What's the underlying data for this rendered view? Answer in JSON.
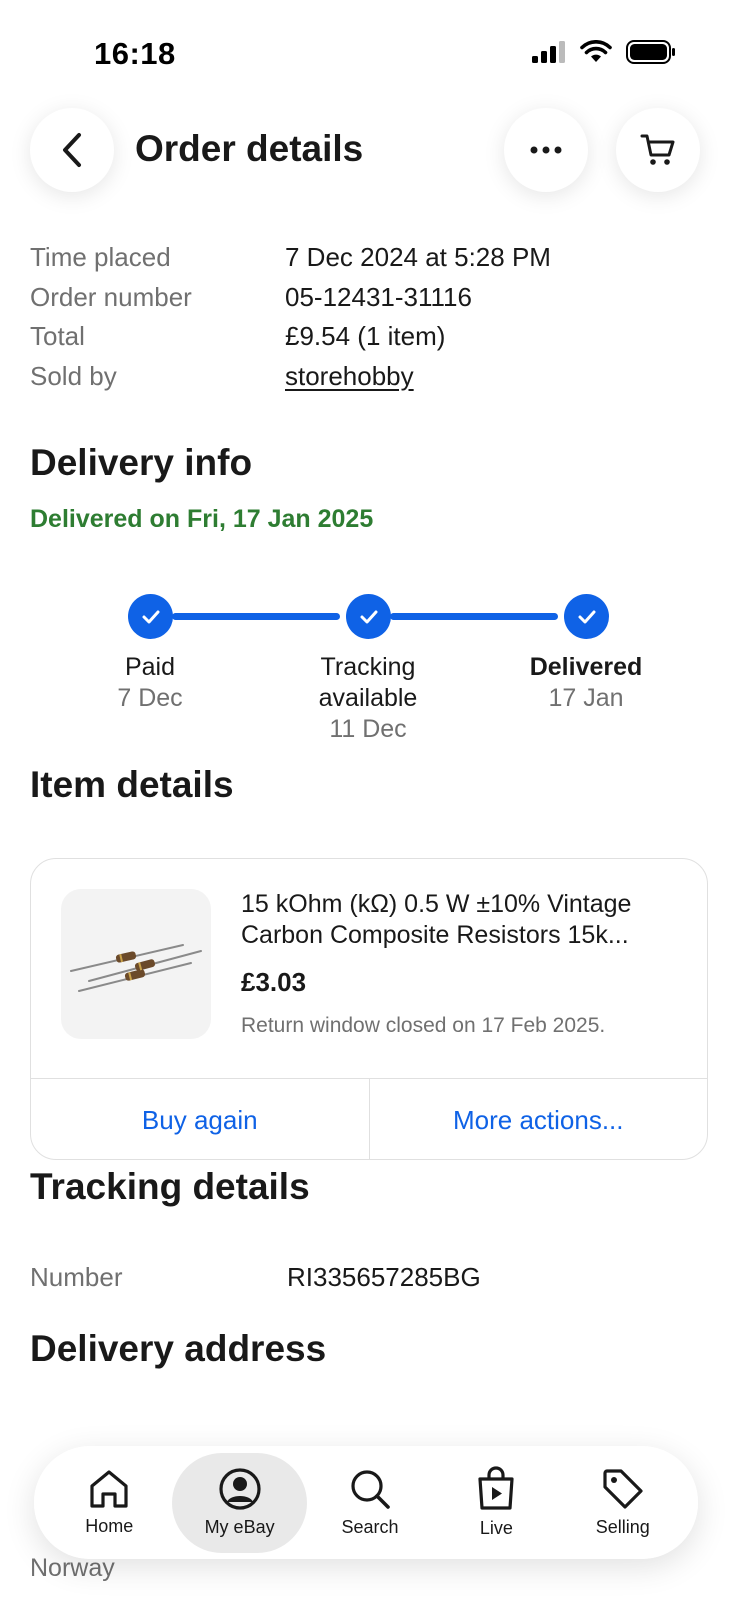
{
  "status_bar": {
    "time": "16:18"
  },
  "header": {
    "title": "Order details"
  },
  "order": {
    "rows": [
      {
        "label": "Time placed",
        "value": "7 Dec 2024 at 5:28 PM"
      },
      {
        "label": "Order number",
        "value": "05-12431-31116"
      },
      {
        "label": "Total",
        "value": "£9.54 (1 item)"
      },
      {
        "label": "Sold by",
        "value": "storehobby"
      }
    ]
  },
  "delivery": {
    "heading": "Delivery info",
    "status": "Delivered on Fri, 17 Jan 2025",
    "steps": [
      {
        "label": "Paid",
        "date": "7 Dec"
      },
      {
        "label": "Tracking available",
        "date": "11 Dec"
      },
      {
        "label": "Delivered",
        "date": "17 Jan"
      }
    ]
  },
  "item_details": {
    "heading": "Item details",
    "title": "15 kOhm (kΩ) 0.5 W ±10% Vintage Carbon Composite Resistors 15k...",
    "price": "£3.03",
    "return_note": "Return window closed on 17 Feb 2025.",
    "buy_again": "Buy again",
    "more_actions": "More actions..."
  },
  "tracking": {
    "heading": "Tracking details",
    "label": "Number",
    "value": "RI335657285BG"
  },
  "address": {
    "heading": "Delivery address",
    "country": "Norway"
  },
  "nav": [
    {
      "label": "Home",
      "icon": "home-icon"
    },
    {
      "label": "My eBay",
      "icon": "user-icon",
      "active": true
    },
    {
      "label": "Search",
      "icon": "search-icon"
    },
    {
      "label": "Live",
      "icon": "live-icon"
    },
    {
      "label": "Selling",
      "icon": "tag-icon"
    }
  ],
  "colors": {
    "accent": "#0f62e6",
    "success": "#2e7d32",
    "muted": "#707070"
  }
}
